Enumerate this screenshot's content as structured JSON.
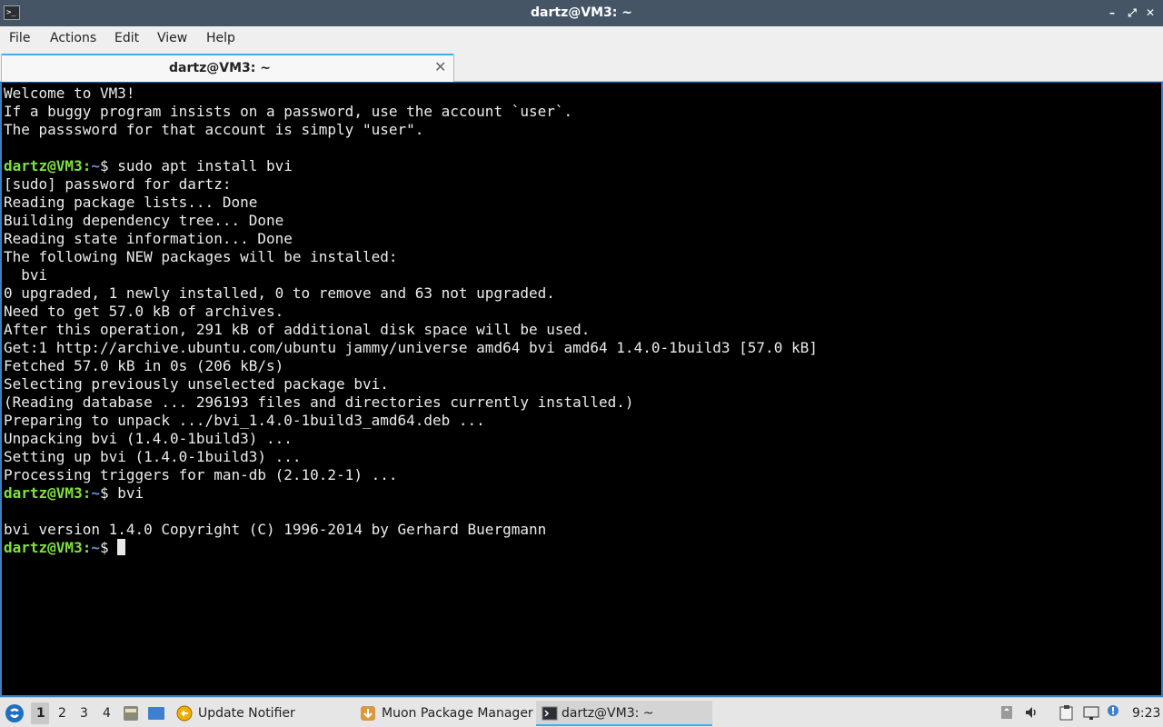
{
  "window": {
    "title": "dartz@VM3: ~",
    "app_icon": "terminal-icon",
    "app_icon_text": ">_",
    "minimize": "–",
    "maximize": "⤢",
    "close": "✕"
  },
  "menubar": {
    "items": [
      "File",
      "Actions",
      "Edit",
      "View",
      "Help"
    ]
  },
  "tabs": [
    {
      "label": "dartz@VM3: ~",
      "close": "✕"
    }
  ],
  "terminal": {
    "lines": [
      {
        "text": "Welcome to VM3!"
      },
      {
        "text": "If a buggy program insists on a password, use the account `user`."
      },
      {
        "text": "The passsword for that account is simply \"user\"."
      },
      {
        "text": ""
      },
      {
        "prompt": true,
        "user": "dartz@VM3",
        "path": "~",
        "cmd": "sudo apt install bvi"
      },
      {
        "text": "[sudo] password for dartz:"
      },
      {
        "text": "Reading package lists... Done"
      },
      {
        "text": "Building dependency tree... Done"
      },
      {
        "text": "Reading state information... Done"
      },
      {
        "text": "The following NEW packages will be installed:"
      },
      {
        "text": "  bvi"
      },
      {
        "text": "0 upgraded, 1 newly installed, 0 to remove and 63 not upgraded."
      },
      {
        "text": "Need to get 57.0 kB of archives."
      },
      {
        "text": "After this operation, 291 kB of additional disk space will be used."
      },
      {
        "text": "Get:1 http://archive.ubuntu.com/ubuntu jammy/universe amd64 bvi amd64 1.4.0-1build3 [57.0 kB]"
      },
      {
        "text": "Fetched 57.0 kB in 0s (206 kB/s)"
      },
      {
        "text": "Selecting previously unselected package bvi."
      },
      {
        "text": "(Reading database ... 296193 files and directories currently installed.)"
      },
      {
        "text": "Preparing to unpack .../bvi_1.4.0-1build3_amd64.deb ..."
      },
      {
        "text": "Unpacking bvi (1.4.0-1build3) ..."
      },
      {
        "text": "Setting up bvi (1.4.0-1build3) ..."
      },
      {
        "text": "Processing triggers for man-db (2.10.2-1) ..."
      },
      {
        "prompt": true,
        "user": "dartz@VM3",
        "path": "~",
        "cmd": "bvi"
      },
      {
        "text": ""
      },
      {
        "text": "bvi version 1.4.0 Copyright (C) 1996-2014 by Gerhard Buergmann"
      },
      {
        "prompt": true,
        "user": "dartz@VM3",
        "path": "~",
        "cmd": "",
        "cursor": true
      }
    ],
    "colors": {
      "user": "#7ee23a",
      "path": "#6b8ed8",
      "text": "#ececec",
      "background": "#000000"
    }
  },
  "taskbar": {
    "menu_icon": "start-menu-icon",
    "desktops": [
      "1",
      "2",
      "3",
      "4"
    ],
    "active_desktop": "1",
    "quicklaunch": [
      "file-manager-icon",
      "show-desktop-icon"
    ],
    "tasks": [
      {
        "label": "Update Notifier",
        "icon": "update-notifier-icon"
      },
      {
        "label": "Muon Package Manager",
        "icon": "package-manager-icon"
      },
      {
        "label": "dartz@VM3: ~",
        "icon": "terminal-icon",
        "active": true
      }
    ],
    "tray": [
      "storage-icon",
      "volume-icon",
      "clipboard-icon",
      "network-icon",
      "notification-icon"
    ],
    "clock": "9:23"
  }
}
